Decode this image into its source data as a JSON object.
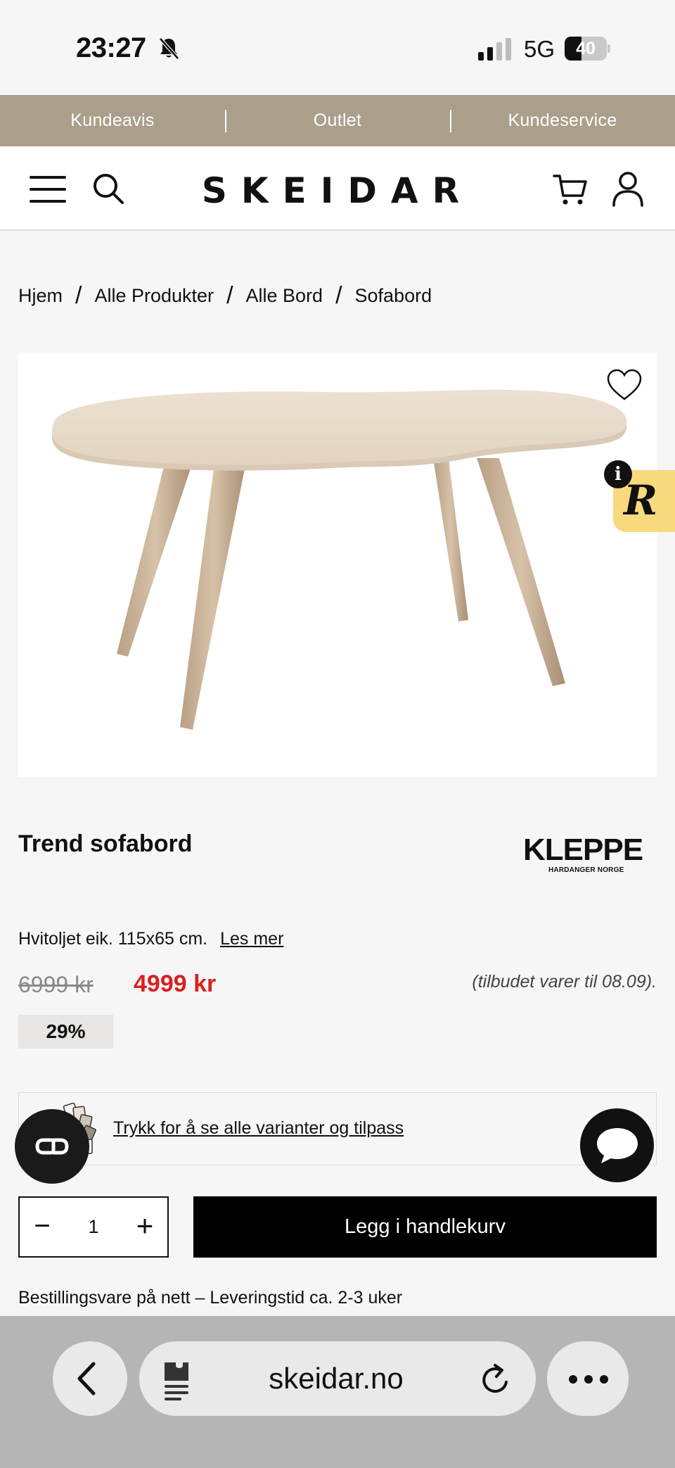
{
  "status_bar": {
    "time": "23:27",
    "network": "5G",
    "battery_level": 40,
    "battery_text": "40",
    "icons": [
      "bell-slash-icon",
      "signal-icon",
      "battery-icon"
    ]
  },
  "promo_bar": {
    "items": [
      "Kundeavis",
      "Outlet",
      "Kundeservice"
    ],
    "background": "#ab9f8b"
  },
  "header": {
    "logo": "SKEIDAR",
    "icons": [
      "menu-icon",
      "search-icon",
      "cart-icon",
      "user-icon"
    ]
  },
  "breadcrumb": {
    "items": [
      "Hjem",
      "Alle Produkter",
      "Alle Bord",
      "Sofabord"
    ],
    "separator": "/"
  },
  "product": {
    "title": "Trend sofabord",
    "brand": {
      "name": "KLEPPE",
      "tagline": "HARDANGER NORGE"
    },
    "description": "Hvitoljet eik. 115x65 cm.",
    "read_more": "Les mer",
    "price_old": "6999 kr",
    "price_new": "4999 kr",
    "offer_note": "(tilbudet varer til 08.09).",
    "discount": "29%",
    "variants_link": "Trykk for å se alle varianter og tilpass",
    "quantity": "1",
    "qty_minus": "−",
    "qty_plus": "+",
    "add_to_cart": "Legg i handlekurv",
    "delivery_note": "Bestillingsvare på nett – Leveringstid ca. 2-3 uker",
    "price_color": "#d9201f"
  },
  "widgets": {
    "recommendation_letter": "R",
    "info": "i"
  },
  "browser": {
    "address": "skeidar.no",
    "icons": [
      "back-icon",
      "extension-icon",
      "reload-icon",
      "more-icon"
    ]
  }
}
